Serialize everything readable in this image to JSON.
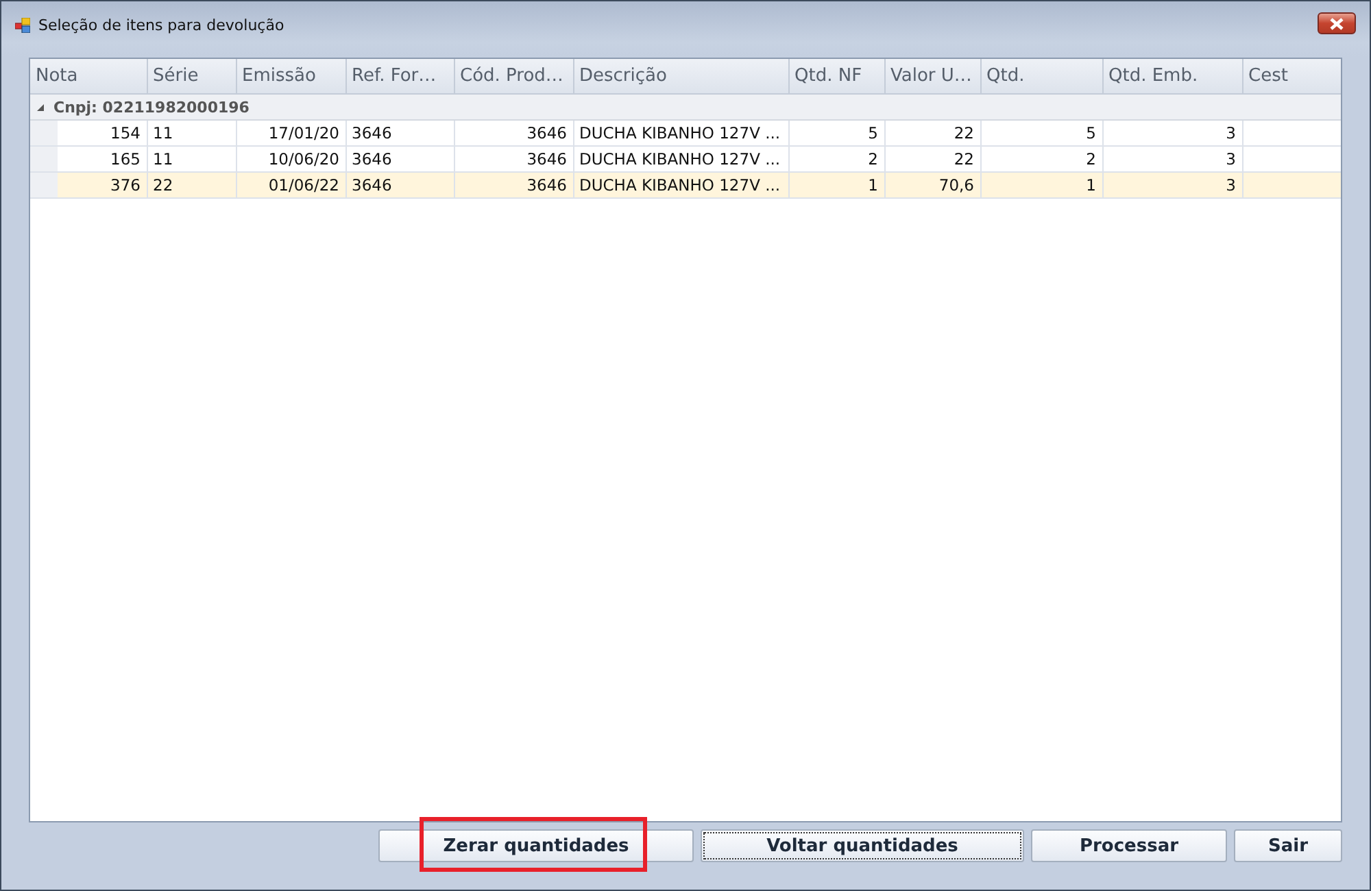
{
  "window": {
    "title": "Seleção de itens para devolução"
  },
  "table": {
    "columns": [
      "Nota",
      "Série",
      "Emissão",
      "Ref. For…",
      "Cód. Prod…",
      "Descrição",
      "Qtd. NF",
      "Valor U…",
      "Qtd.",
      "Qtd. Emb.",
      "Cest"
    ],
    "groups": [
      {
        "label": "Cnpj: 02211982000196",
        "expanded": true,
        "rows": [
          {
            "selected": false,
            "cells": [
              "154",
              "11",
              "17/01/20",
              "3646",
              "3646",
              "DUCHA KIBANHO 127V ...",
              "5",
              "22",
              "5",
              "3",
              ""
            ]
          },
          {
            "selected": false,
            "cells": [
              "165",
              "11",
              "10/06/20",
              "3646",
              "3646",
              "DUCHA KIBANHO 127V ...",
              "2",
              "22",
              "2",
              "3",
              ""
            ]
          },
          {
            "selected": true,
            "cells": [
              "376",
              "22",
              "01/06/22",
              "3646",
              "3646",
              "DUCHA KIBANHO 127V ...",
              "1",
              "70,6",
              "1",
              "3",
              ""
            ]
          }
        ]
      }
    ]
  },
  "buttons": [
    {
      "label": "Zerar quantidades",
      "focused": false,
      "highlighted": true
    },
    {
      "label": "Voltar quantidades",
      "focused": true,
      "highlighted": false
    },
    {
      "label": "Processar",
      "focused": false,
      "highlighted": false
    },
    {
      "label": "Sair",
      "focused": false,
      "highlighted": false
    }
  ]
}
